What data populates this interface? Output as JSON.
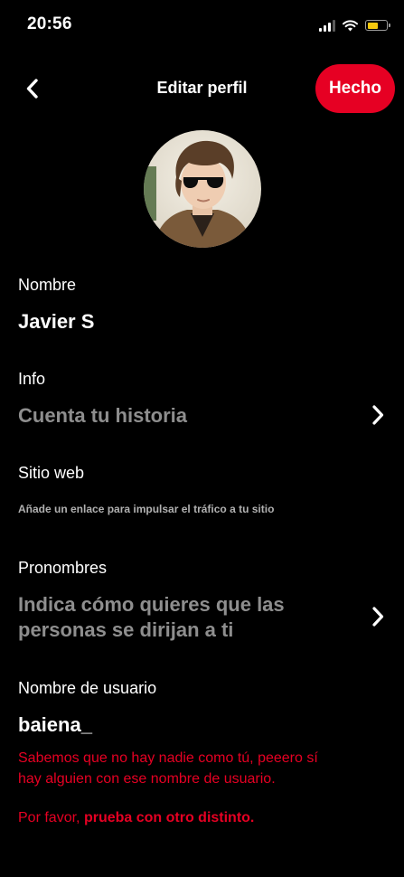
{
  "status_bar": {
    "time": "20:56",
    "signal_icon": "cellular-signal-icon",
    "wifi_icon": "wifi-icon",
    "battery_icon": "battery-icon",
    "battery_level": 0.55,
    "battery_color": "#f6c90e"
  },
  "nav": {
    "back_icon": "chevron-left-icon",
    "title": "Editar perfil",
    "done_label": "Hecho",
    "accent_color": "#e60023"
  },
  "profile": {
    "avatar_icon": "profile-photo"
  },
  "fields": {
    "name": {
      "label": "Nombre",
      "value": "Javier S"
    },
    "info": {
      "label": "Info",
      "placeholder": "Cuenta tu historia",
      "chevron_icon": "chevron-right-icon"
    },
    "website": {
      "label": "Sitio web",
      "hint": "Añade un enlace para impulsar el tráfico a tu sitio"
    },
    "pronouns": {
      "label": "Pronombres",
      "placeholder_line1": "Indica cómo quieres que las",
      "placeholder_line2": "personas se dirijan a ti",
      "chevron_icon": "chevron-right-icon"
    },
    "username": {
      "label": "Nombre de usuario",
      "value": "baiena_",
      "error_line1": "Sabemos que no hay nadie como tú, peeero sí",
      "error_line2": "hay alguien con ese nombre de usuario.",
      "error_prefix": "Por favor,",
      "error_emphasis": "prueba con otro distinto."
    }
  }
}
